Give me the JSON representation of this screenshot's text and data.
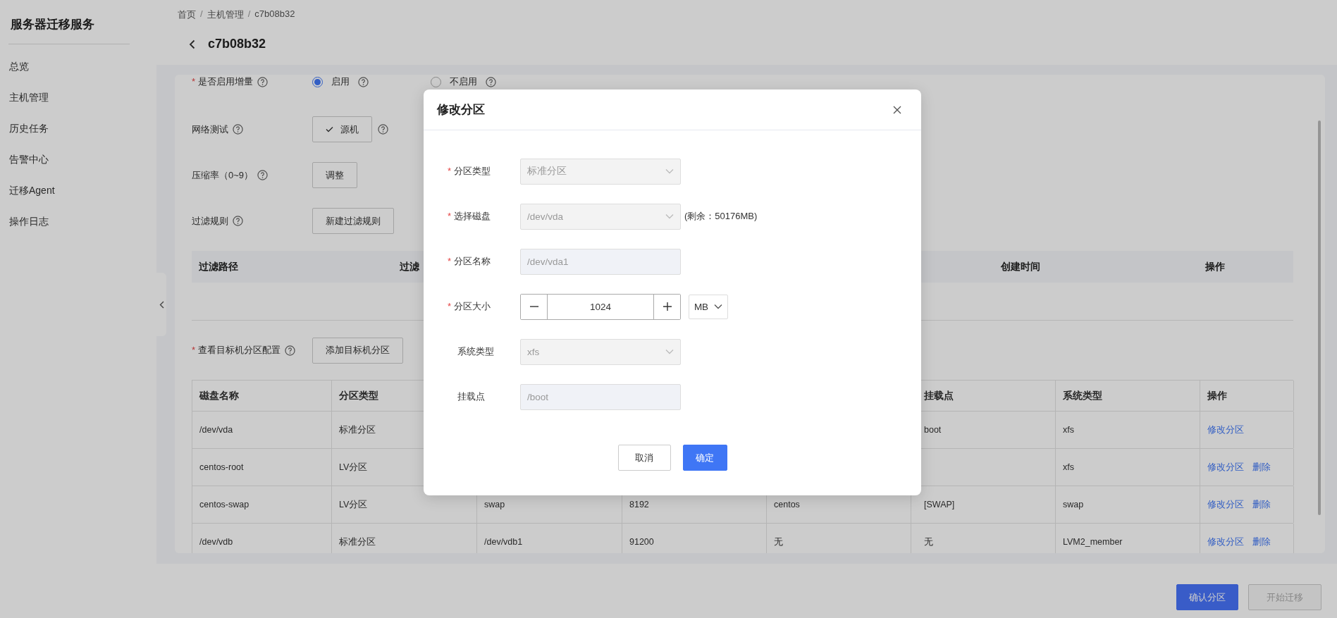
{
  "sidebar": {
    "title": "服务器迁移服务",
    "items": [
      {
        "label": "总览",
        "selected": false
      },
      {
        "label": "主机管理",
        "selected": false
      },
      {
        "label": "历史任务",
        "selected": false
      },
      {
        "label": "告警中心",
        "selected": false
      },
      {
        "label": "迁移Agent",
        "selected": false
      },
      {
        "label": "操作日志",
        "selected": false
      }
    ]
  },
  "breadcrumb": {
    "separator": "/",
    "items": [
      "首页",
      "主机管理",
      "c7b08b32"
    ]
  },
  "page_title": "c7b08b32",
  "required_mark": "*",
  "form": [
    {
      "kind": "radio",
      "label": "是否启用增量",
      "required": true,
      "options": [
        {
          "label": "启用",
          "selected": true
        },
        {
          "label": "不启用",
          "selected": false
        }
      ]
    },
    {
      "kind": "button",
      "label": "网络测试",
      "required": false,
      "button": "源机",
      "checked": true,
      "trailing_help": true
    },
    {
      "kind": "button",
      "label": "压缩率（0~9）",
      "required": false,
      "button": "调整",
      "checked": false,
      "trailing_help": false
    },
    {
      "kind": "button",
      "label": "过滤规则",
      "required": false,
      "button": "新建过滤规则",
      "checked": false,
      "trailing_help": false
    }
  ],
  "filter_table": {
    "columns": [
      "过滤路径",
      "过滤",
      "创建时间",
      "操作"
    ]
  },
  "partition_section": {
    "label": "查看目标机分区配置",
    "required": true,
    "button": "添加目标机分区"
  },
  "partition_table": {
    "columns": [
      {
        "label": "磁盘名称"
      },
      {
        "label": "分区类型"
      },
      {},
      {},
      {},
      {
        "label": "挂载点"
      },
      {
        "label": "系统类型"
      },
      {
        "label": "操作"
      }
    ],
    "rows": [
      {
        "cells": [
          "/dev/vda",
          "标准分区",
          null,
          null,
          null,
          "boot",
          "xfs"
        ],
        "actions": [
          "修改分区"
        ]
      },
      {
        "cells": [
          "centos-root",
          "LV分区",
          null,
          null,
          null,
          null,
          "xfs"
        ],
        "actions": [
          "修改分区",
          "删除"
        ]
      },
      {
        "cells": [
          "centos-swap",
          "LV分区",
          "swap",
          "8192",
          "centos",
          "[SWAP]",
          "swap"
        ],
        "actions": [
          "修改分区",
          "删除"
        ]
      },
      {
        "cells": [
          "/dev/vdb",
          "标准分区",
          "/dev/vdb1",
          "91200",
          "无",
          "无",
          "LVM2_member"
        ],
        "actions": [
          "修改分区",
          "删除"
        ]
      }
    ]
  },
  "footer_buttons": [
    {
      "label": "确认分区",
      "disabled": false
    },
    {
      "label": "开始迁移",
      "disabled": true
    }
  ],
  "dialog": {
    "title": "修改分区",
    "fields": [
      {
        "kind": "select",
        "label": "分区类型",
        "required": true,
        "value": "标准分区",
        "disabled": true
      },
      {
        "kind": "select",
        "label": "选择磁盘",
        "required": true,
        "value": "/dev/vda",
        "disabled": true,
        "note": "(剩余：50176MB)"
      },
      {
        "kind": "input",
        "label": "分区名称",
        "required": true,
        "value": "/dev/vda1",
        "disabled": true
      },
      {
        "kind": "stepper",
        "label": "分区大小",
        "required": true,
        "value": "1024",
        "unit": "MB",
        "disabled": false
      },
      {
        "kind": "select",
        "label": "系统类型",
        "required": false,
        "value": "xfs",
        "disabled": true
      },
      {
        "kind": "input",
        "label": "挂载点",
        "required": false,
        "value": "/boot",
        "disabled": true
      }
    ],
    "buttons": [
      {
        "label": "取消",
        "primary": false
      },
      {
        "label": "确定",
        "primary": true
      }
    ]
  }
}
